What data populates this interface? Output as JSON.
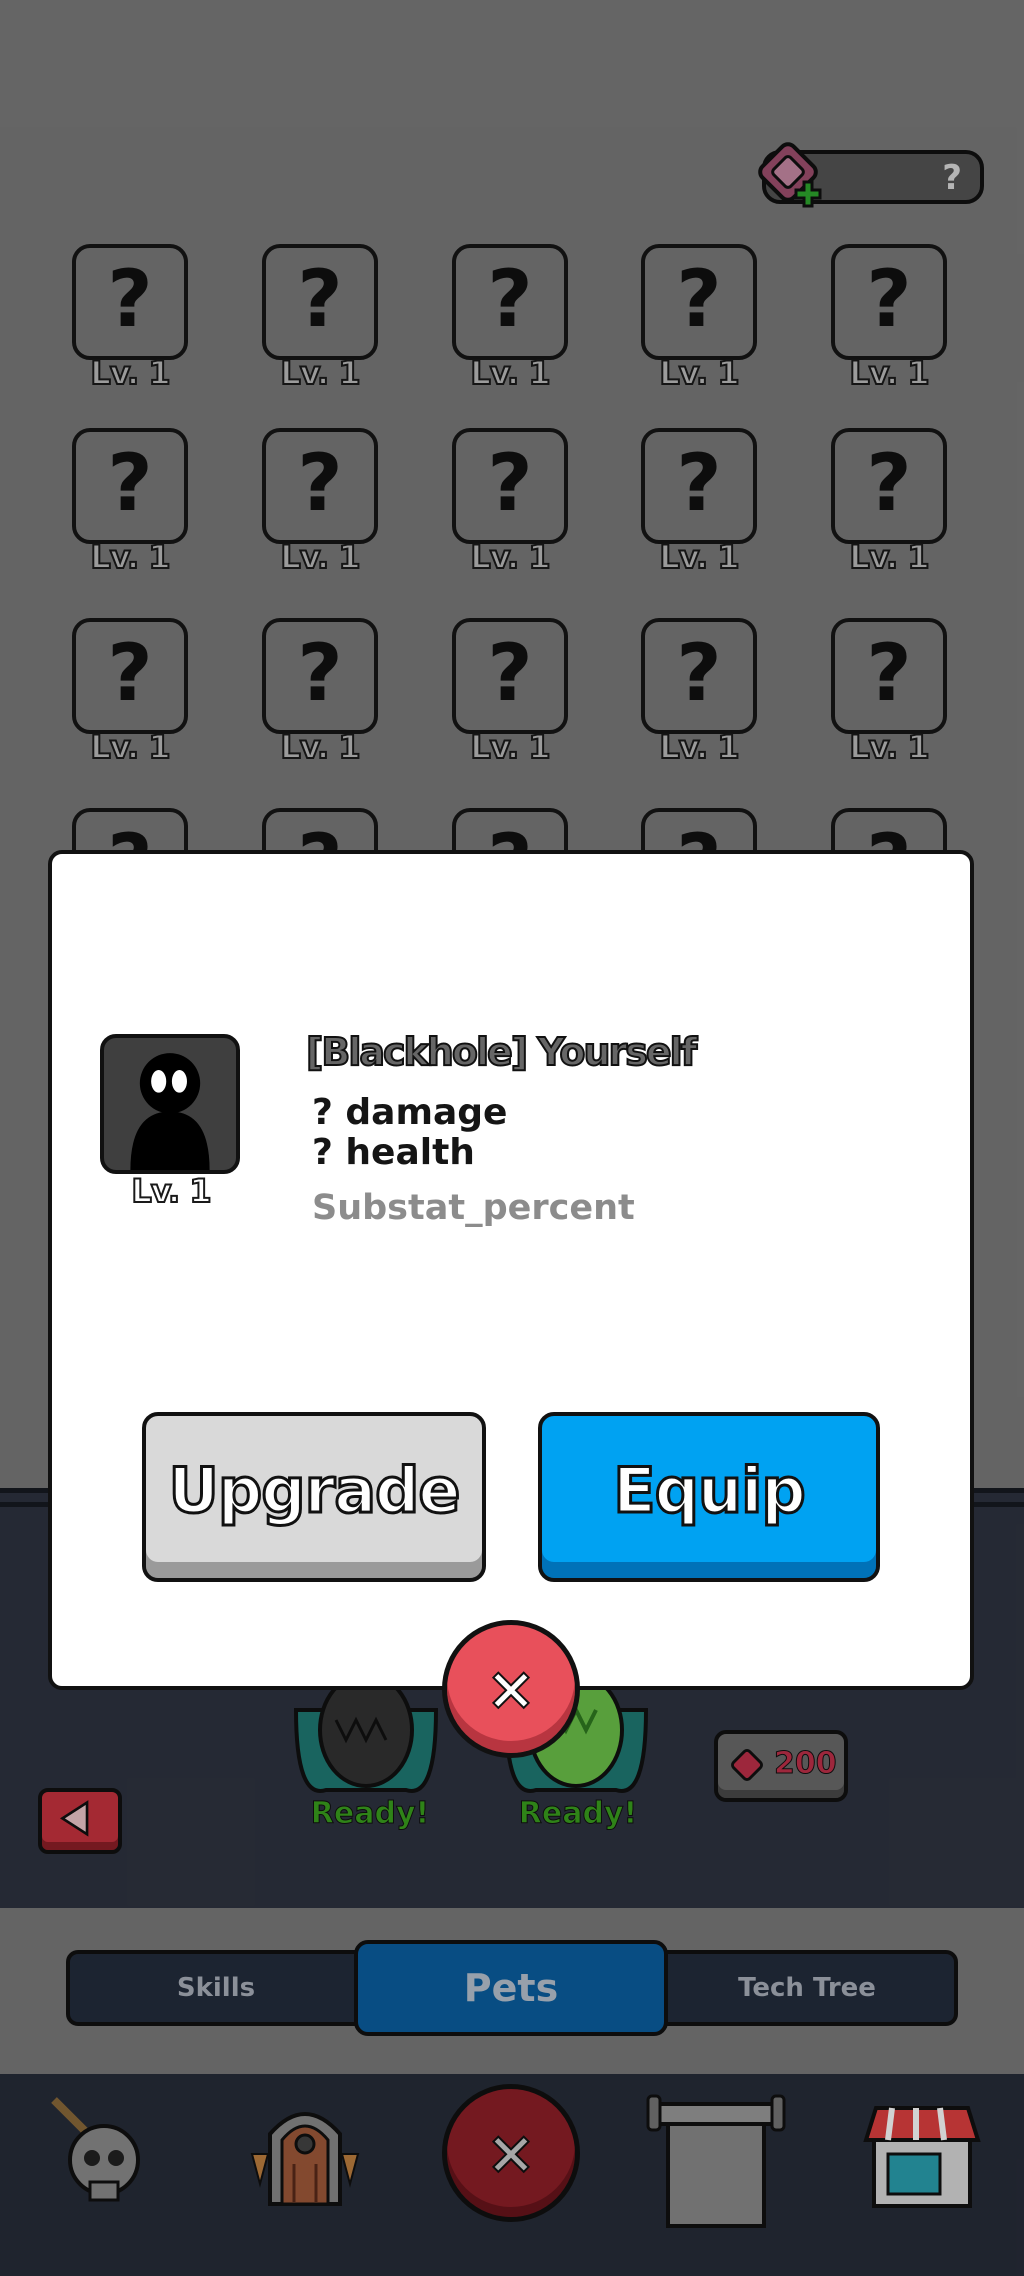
{
  "currency": {
    "gem_count": "?",
    "icon": "gem-plus-icon"
  },
  "pet_grid": {
    "level_label": "Lv. 1",
    "unknown_symbol": "?"
  },
  "modal": {
    "title": "[Blackhole] Yourself",
    "level": "Lv. 1",
    "stats": [
      "? damage",
      "? health"
    ],
    "substat": "Substat_percent",
    "upgrade_label": "Upgrade",
    "equip_label": "Equip",
    "close_symbol": "×"
  },
  "eggs": [
    {
      "status": "Ready!",
      "color": "dark"
    },
    {
      "status": "Ready!",
      "color": "green"
    }
  ],
  "egg_price": {
    "value": "200",
    "icon": "gem-icon"
  },
  "tabs": [
    {
      "label": "Skills",
      "active": false
    },
    {
      "label": "Pets",
      "active": true
    },
    {
      "label": "Tech Tree",
      "active": false
    }
  ],
  "bottom_nav": [
    {
      "name": "skull-sword-icon"
    },
    {
      "name": "dungeon-door-icon"
    },
    {
      "name": "close-icon"
    },
    {
      "name": "scroll-banner-icon"
    },
    {
      "name": "shop-icon"
    }
  ],
  "colors": {
    "accent_blue": "#00a2f2",
    "close_red": "#e8505b",
    "ready_green": "#3aa01e"
  }
}
